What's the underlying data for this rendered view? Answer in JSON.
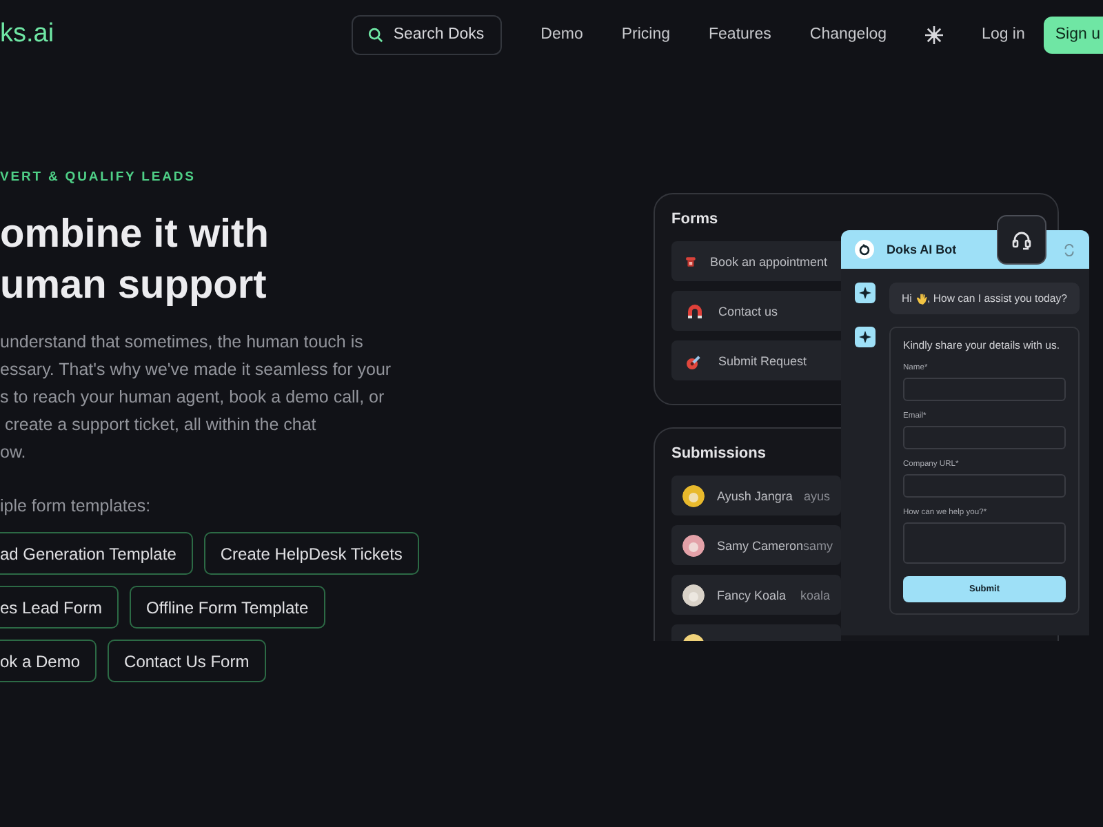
{
  "nav": {
    "logo": "ks.ai",
    "search": "Search Doks",
    "links": [
      "Demo",
      "Pricing",
      "Features",
      "Changelog"
    ],
    "login": "Log in",
    "signup": "Sign u"
  },
  "hero": {
    "eyebrow": "VERT & QUALIFY LEADS",
    "title": [
      "ombine it with",
      "uman support"
    ],
    "paragraph": [
      "understand that sometimes, the human touch is",
      "essary. That's why we've made it seamless for your",
      "s to reach your human agent, book a demo call, or",
      " create a support ticket, all within the chat",
      "ow."
    ],
    "templates_label": "iple form templates:",
    "chip_rows": [
      [
        "ad Generation Template",
        "Create HelpDesk Tickets"
      ],
      [
        "es Lead Form",
        "Offline Form Template"
      ],
      [
        "ok a Demo",
        "Contact Us Form"
      ]
    ]
  },
  "forms": {
    "title": "Forms",
    "items": [
      {
        "kind": "phone",
        "label": "Book an appointment"
      },
      {
        "kind": "magnet",
        "label": "Contact us"
      },
      {
        "kind": "guitar",
        "label": "Submit Request"
      }
    ]
  },
  "submissions": {
    "title": "Submissions",
    "rows": [
      {
        "name": "Ayush Jangra",
        "email": "ayus",
        "color": "#e8b92c"
      },
      {
        "name": "Samy Cameron",
        "email": "samy",
        "color": "#e3a1a8"
      },
      {
        "name": "Fancy Koala",
        "email": "koala",
        "color": "#d9d2c8"
      }
    ]
  },
  "chat": {
    "title": "Doks AI Bot",
    "greeting_before": "Hi",
    "greeting_after": ", How can I assist you today?",
    "prompt": "Kindly share your details with us.",
    "fields": [
      {
        "kind": "input",
        "label": "Name*"
      },
      {
        "kind": "input",
        "label": "Email*"
      },
      {
        "kind": "input",
        "label": "Company URL*"
      },
      {
        "kind": "textarea",
        "label": "How can we help you?*"
      }
    ],
    "submit": "Submit"
  }
}
